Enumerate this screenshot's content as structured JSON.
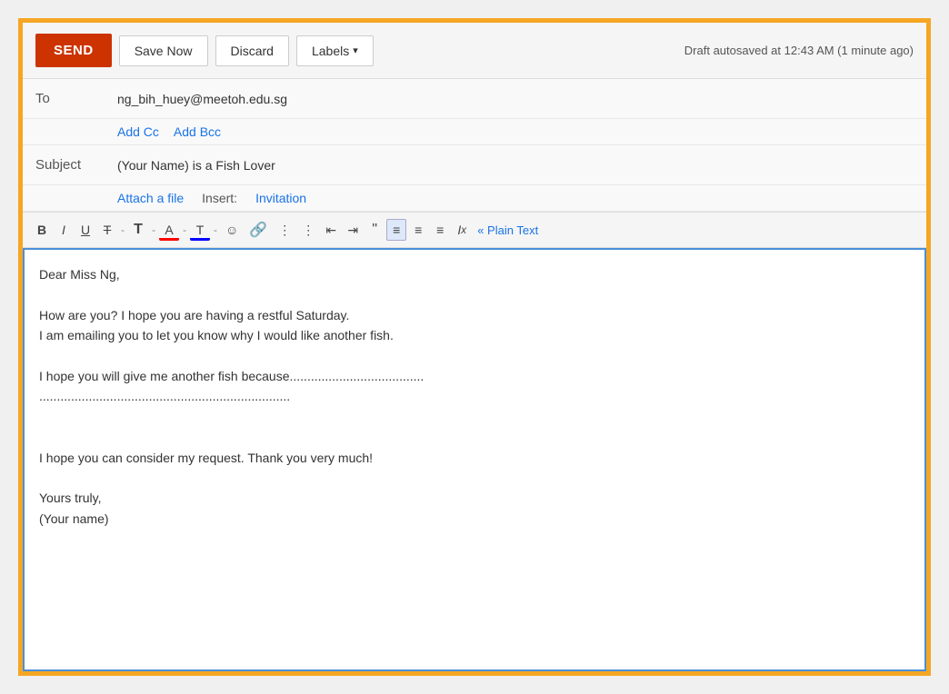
{
  "toolbar": {
    "send_label": "SEND",
    "save_now_label": "Save Now",
    "discard_label": "Discard",
    "labels_label": "Labels",
    "draft_info": "Draft autosaved at 12:43 AM (1 minute ago)"
  },
  "fields": {
    "to_label": "To",
    "to_value": "ng_bih_huey@meetoh.edu.sg",
    "add_cc_label": "Add Cc",
    "add_bcc_label": "Add Bcc",
    "subject_label": "Subject",
    "subject_value": "(Your Name) is a Fish Lover",
    "attach_label": "Attach a file",
    "insert_label": "Insert:",
    "invitation_label": "Invitation"
  },
  "formatting": {
    "bold": "B",
    "italic": "I",
    "underline": "U",
    "strikethrough": "T",
    "font_size": "T",
    "font_color": "A",
    "text_color": "T",
    "emoji": "☺",
    "link": "∞",
    "ordered_list": "≡",
    "unordered_list": "≡",
    "indent_less": "⇤",
    "indent_more": "⇥",
    "quote": "❝",
    "align_center": "≡",
    "align_left": "≡",
    "align_right": "≡",
    "clear_format": "Ix",
    "plain_text": "« Plain Text"
  },
  "body": {
    "line1": "Dear Miss Ng,",
    "line2": "",
    "line3": "How are you? I hope you are having a restful Saturday.",
    "line4": "I am emailing you to let you know why I would like another fish.",
    "line5": "",
    "line6": "I hope you will give me another fish because......................................",
    "line7": ".......................................................................",
    "line8": "",
    "line9": "",
    "line10": "I hope you can consider my request. Thank you very much!",
    "line11": "",
    "line12": "Yours truly,",
    "line13": "(Your name)"
  }
}
